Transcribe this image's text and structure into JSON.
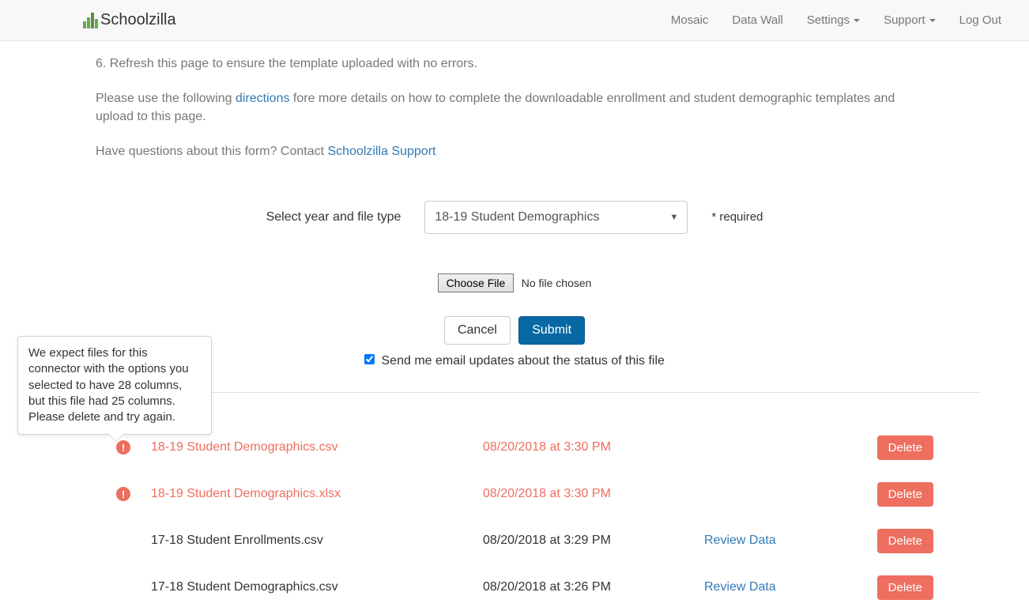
{
  "brand": "Schoolzilla",
  "nav": {
    "mosaic": "Mosaic",
    "dataWall": "Data Wall",
    "settings": "Settings",
    "support": "Support",
    "logout": "Log Out"
  },
  "content": {
    "step6": "6. Refresh this page to ensure the template uploaded with no errors.",
    "directionsPrefix": "Please use the following ",
    "directionsLink": "directions",
    "directionsSuffix": " fore more details on how to complete the downloadable enrollment and student demographic templates and upload to this page.",
    "questionsPrefix": "Have questions about this form? Contact ",
    "questionsLink": "Schoolzilla Support"
  },
  "form": {
    "selectLabel": "Select year and file type",
    "selectedOption": "18-19 Student Demographics",
    "required": "* required",
    "chooseFile": "Choose File",
    "noFile": "No file chosen",
    "cancel": "Cancel",
    "submit": "Submit",
    "emailUpdates": "Send me email updates about the status of this file"
  },
  "tooltip": "We expect files for this connector with the options you selected to have 28 columns, but this file had 25 columns. Please delete and try again.",
  "files": [
    {
      "name": "18-19 Student Demographics.csv",
      "date": "08/20/2018 at 3:30 PM",
      "error": true,
      "review": ""
    },
    {
      "name": "18-19 Student Demographics.xlsx",
      "date": "08/20/2018 at 3:30 PM",
      "error": true,
      "review": ""
    },
    {
      "name": "17-18 Student Enrollments.csv",
      "date": "08/20/2018 at 3:29 PM",
      "error": false,
      "review": "Review Data"
    },
    {
      "name": "17-18 Student Demographics.csv",
      "date": "08/20/2018 at 3:26 PM",
      "error": false,
      "review": "Review Data"
    }
  ],
  "deleteLabel": "Delete"
}
